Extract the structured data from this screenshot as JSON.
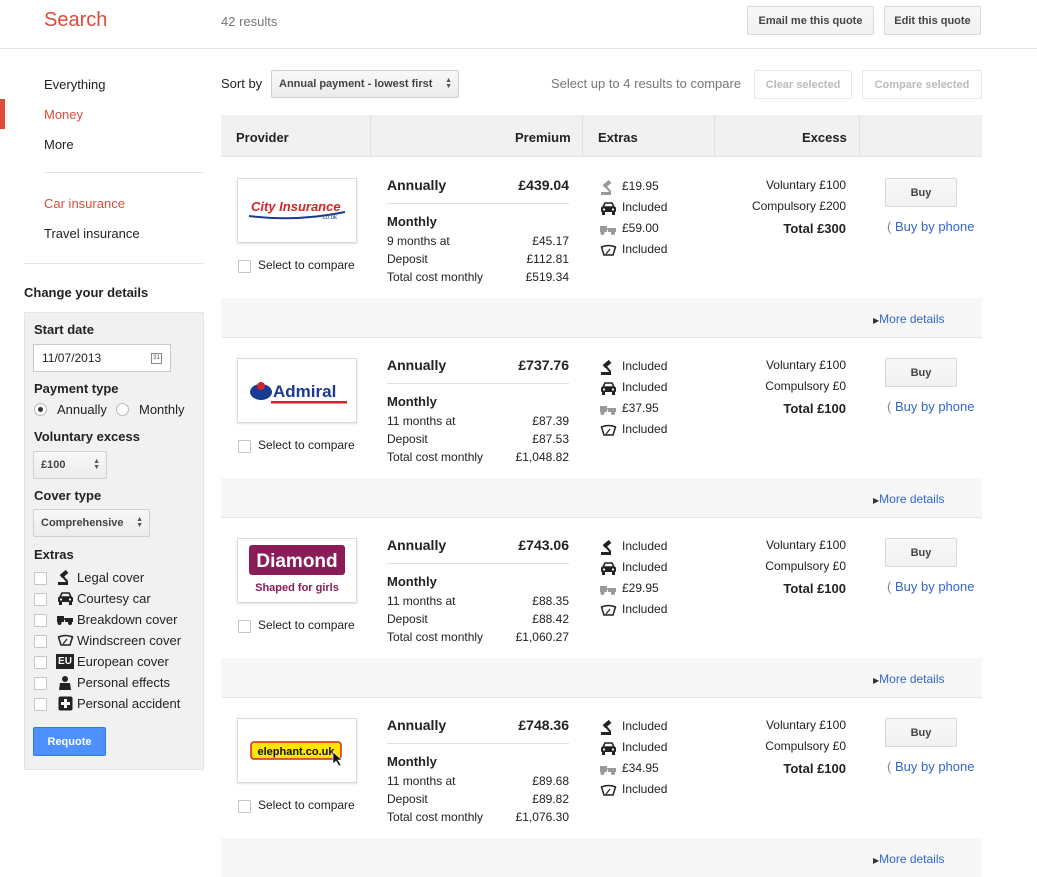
{
  "header": {
    "title": "Search",
    "results_count": "42 results",
    "email_button": "Email me this quote",
    "edit_button": "Edit this quote"
  },
  "nav": {
    "items": [
      {
        "label": "Everything"
      },
      {
        "label": "Money"
      },
      {
        "label": "More"
      }
    ],
    "sub_items": [
      {
        "label": "Car insurance"
      },
      {
        "label": "Travel insurance"
      }
    ]
  },
  "details": {
    "heading": "Change your details",
    "start_date_label": "Start date",
    "start_date_value": "11/07/2013",
    "calendar_day": "31",
    "payment_type_label": "Payment type",
    "payment_options": [
      "Annually",
      "Monthly"
    ],
    "payment_selected": "Annually",
    "voluntary_excess_label": "Voluntary excess",
    "voluntary_excess_value": "£100",
    "cover_type_label": "Cover type",
    "cover_type_value": "Comprehensive",
    "extras_label": "Extras",
    "extras": [
      {
        "label": "Legal cover",
        "icon": "gavel-icon"
      },
      {
        "label": "Courtesy car",
        "icon": "car-icon"
      },
      {
        "label": "Breakdown cover",
        "icon": "breakdown-icon"
      },
      {
        "label": "Windscreen cover",
        "icon": "windscreen-icon"
      },
      {
        "label": "European cover",
        "icon": "eu-icon",
        "icon_text": "EU"
      },
      {
        "label": "Personal effects",
        "icon": "personal-effects-icon"
      },
      {
        "label": "Personal accident",
        "icon": "first-aid-icon"
      }
    ],
    "requote_button": "Requote"
  },
  "sort": {
    "label": "Sort by",
    "value": "Annual payment - lowest first",
    "compare_hint": "Select up to 4 results to compare",
    "clear_button": "Clear selected",
    "compare_button": "Compare selected"
  },
  "table": {
    "headers": {
      "provider": "Provider",
      "premium": "Premium",
      "extras": "Extras",
      "excess": "Excess"
    }
  },
  "labels": {
    "select_compare": "Select to compare",
    "annually": "Annually",
    "monthly": "Monthly",
    "months_at_suffix": "months at",
    "deposit": "Deposit",
    "total_cost_monthly": "Total cost monthly",
    "buy": "Buy",
    "buy_by_phone": "Buy by phone",
    "more_details": "More details"
  },
  "results": [
    {
      "provider": "City Insurance",
      "logo_sub": ".co.uk",
      "annual": "£439.04",
      "months_at": "9 months at",
      "monthly": "£45.17",
      "deposit": "£112.81",
      "total_monthly": "£519.34",
      "extras": [
        "£19.95",
        "Included",
        "£59.00",
        "Included"
      ],
      "voluntary": "Voluntary £100",
      "compulsory": "Compulsory £200",
      "total": "Total £300"
    },
    {
      "provider": "Admiral",
      "annual": "£737.76",
      "months_at": "11 months at",
      "monthly": "£87.39",
      "deposit": "£87.53",
      "total_monthly": "£1,048.82",
      "extras": [
        "Included",
        "Included",
        "£37.95",
        "Included"
      ],
      "voluntary": "Voluntary £100",
      "compulsory": "Compulsory £0",
      "total": "Total £100"
    },
    {
      "provider": "Diamond",
      "logo_sub": "Shaped for girls",
      "annual": "£743.06",
      "months_at": "11 months at",
      "monthly": "£88.35",
      "deposit": "£88.42",
      "total_monthly": "£1,060.27",
      "extras": [
        "Included",
        "Included",
        "£29.95",
        "Included"
      ],
      "voluntary": "Voluntary £100",
      "compulsory": "Compulsory £0",
      "total": "Total £100"
    },
    {
      "provider": "elephant.co.uk",
      "annual": "£748.36",
      "months_at": "11 months at",
      "monthly": "£89.68",
      "deposit": "£89.82",
      "total_monthly": "£1,076.30",
      "extras": [
        "Included",
        "Included",
        "£34.95",
        "Included"
      ],
      "voluntary": "Voluntary £100",
      "compulsory": "Compulsory £0",
      "total": "Total £100"
    }
  ],
  "colors": {
    "accent": "#dd4b39",
    "link": "#3366cc",
    "primary_button": "#4d90fe"
  }
}
